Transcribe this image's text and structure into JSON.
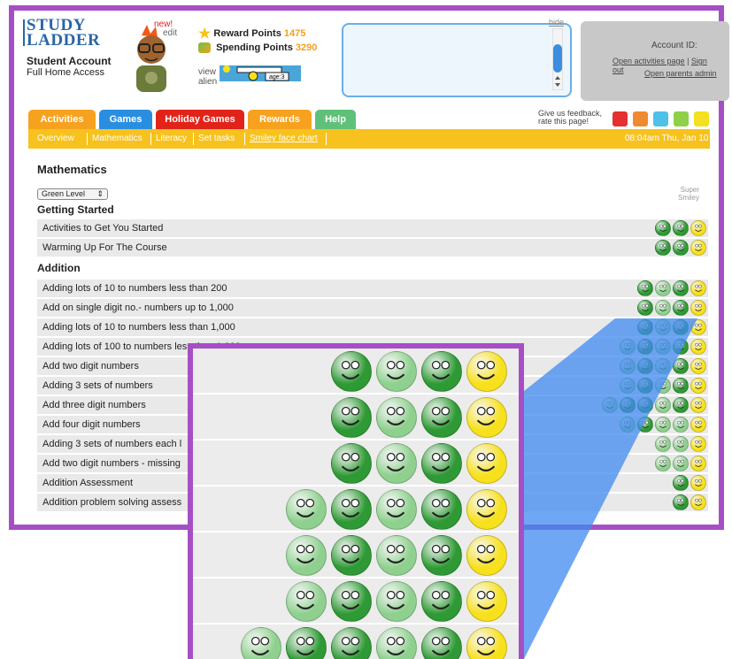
{
  "logo": {
    "line1": "STUDY",
    "line2": "LADDER"
  },
  "account": {
    "title": "Student Account",
    "subtitle": "Full Home Access"
  },
  "avatar": {
    "new_badge": "new!",
    "edit_label": "edit"
  },
  "points": {
    "reward_label": "Reward Points",
    "reward_value": "1475",
    "spending_label": "Spending Points",
    "spending_value": "3290"
  },
  "alien": {
    "view": "view",
    "alien": "alien",
    "age": "age:3"
  },
  "message_box": {
    "hide_label": "hide"
  },
  "account_box": {
    "id_label": "Account ID:",
    "open_activities": "Open activities page",
    "sign_out": "Sign out",
    "open_parents": "Open parents admin"
  },
  "tabs": [
    {
      "label": "Activities",
      "color": "#f7a21e"
    },
    {
      "label": "Games",
      "color": "#2a8ee0"
    },
    {
      "label": "Holiday Games",
      "color": "#e2231a"
    },
    {
      "label": "Rewards",
      "color": "#f7a21e"
    },
    {
      "label": "Help",
      "color": "#5fc07a"
    }
  ],
  "subnav": [
    "Overview",
    "Mathematics",
    "Literacy",
    "Set tasks",
    "Smiley face chart"
  ],
  "feedback": {
    "line1": "Give us feedback,",
    "line2": "rate this page!"
  },
  "datetime": "08:04am Thu, Jan 10",
  "section": {
    "title": "Mathematics",
    "level_select": "Green Level",
    "super_line1": "Super",
    "super_line2": "Smiley"
  },
  "groups": {
    "getting_started": "Getting Started",
    "addition": "Addition"
  },
  "activities": [
    {
      "label": "Activities to Get You Started",
      "faces": [
        "dark",
        "dark",
        "yellow"
      ]
    },
    {
      "label": "Warming Up For The Course",
      "faces": [
        "dark",
        "dark",
        "yellow"
      ]
    },
    {
      "label": "Adding lots of 10 to numbers less than 200",
      "faces": [
        "dark",
        "light",
        "dark",
        "yellow"
      ]
    },
    {
      "label": "Add on single digit no.- numbers up to 1,000",
      "faces": [
        "dark",
        "light",
        "dark",
        "yellow"
      ]
    },
    {
      "label": "Adding lots of 10 to numbers less than 1,000",
      "faces": [
        "dark",
        "light",
        "dark",
        "yellow"
      ]
    },
    {
      "label": "Adding lots of 100 to numbers less than 1,000",
      "faces": [
        "light",
        "dark",
        "light",
        "dark",
        "yellow"
      ]
    },
    {
      "label": "Add two digit numbers",
      "faces": [
        "light",
        "dark",
        "light",
        "dark",
        "yellow"
      ]
    },
    {
      "label": "Adding 3 sets of numbers",
      "faces": [
        "light",
        "dark",
        "light",
        "dark",
        "yellow"
      ]
    },
    {
      "label": "Add three digit numbers",
      "faces": [
        "light",
        "dark",
        "dark",
        "light",
        "dark",
        "yellow"
      ]
    },
    {
      "label": "Add four digit numbers",
      "faces": [
        "light",
        "dark",
        "light",
        "light",
        "yellow"
      ]
    },
    {
      "label": "Adding 3 sets of numbers each l",
      "faces": [
        "light",
        "light",
        "yellow"
      ]
    },
    {
      "label": "Add two digit numbers - missing",
      "faces": [
        "light",
        "light",
        "yellow"
      ]
    },
    {
      "label": "Addition Assessment",
      "faces": [
        "dark",
        "yellow"
      ]
    },
    {
      "label": "Addition problem solving assess",
      "faces": [
        "dark",
        "yellow"
      ]
    }
  ],
  "zoom_rows": [
    [
      "dark",
      "light",
      "dark",
      "yellow"
    ],
    [
      "dark",
      "light",
      "dark",
      "yellow"
    ],
    [
      "dark",
      "light",
      "dark",
      "yellow"
    ],
    [
      "light",
      "dark",
      "light",
      "dark",
      "yellow"
    ],
    [
      "light",
      "dark",
      "light",
      "dark",
      "yellow"
    ],
    [
      "light",
      "dark",
      "light",
      "dark",
      "yellow"
    ],
    [
      "light",
      "dark",
      "dark",
      "light",
      "dark",
      "yellow"
    ]
  ],
  "face_colors": {
    "dark": "#2f9a35",
    "light": "#8fd08f",
    "yellow": "#f7e01c"
  },
  "rate_colors": [
    "#e53030",
    "#f08a30",
    "#4fc0e8",
    "#8ed04a",
    "#f3e020"
  ]
}
